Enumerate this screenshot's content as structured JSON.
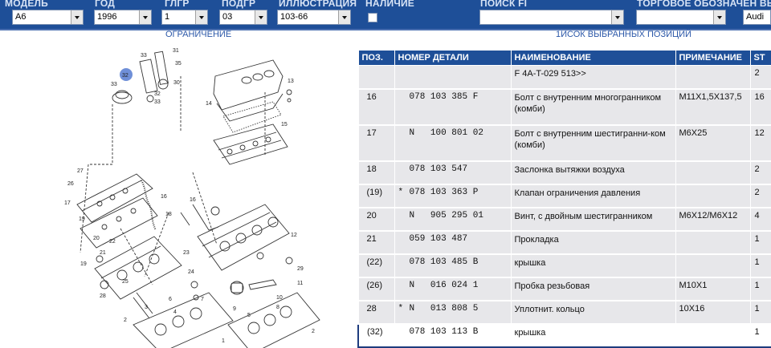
{
  "filters": {
    "model": {
      "label": "МОДЕЛЬ",
      "value": "A6"
    },
    "year": {
      "label": "ГОД",
      "value": "1996"
    },
    "main_group": {
      "label": "ГЛГР",
      "value": "1"
    },
    "sub_group": {
      "label": "ПОДГР",
      "value": "03"
    },
    "illustration": {
      "label": "ИЛЛЮСТРАЦИЯ",
      "value": "103-66"
    },
    "availability": {
      "label": "НАЛИЧИЕ"
    },
    "search": {
      "label": "ПОИСК FI",
      "value": ""
    },
    "trade": {
      "label": "ТОРГОВОЕ ОБОЗНАЧЕН ВЫБО",
      "value": "Audi"
    }
  },
  "subheader": {
    "left": "ОГРАНИЧЕНИЕ",
    "right": "1ИСОК ВЫБРАННЫХ ПОЗИЦИЙ"
  },
  "table": {
    "columns": [
      "ПОЗ.",
      "НОМЕР ДЕТАЛИ",
      "НАИМЕНОВАНИЕ",
      "ПРИМЕЧАНИЕ",
      "ST"
    ],
    "rows": [
      {
        "pos": "",
        "star": "",
        "part": "",
        "name": "F 4A-T-029 513>>",
        "note": "",
        "qty": "2",
        "tall": false,
        "selected": false
      },
      {
        "pos": "16",
        "star": "",
        "part": "078 103 385 F",
        "name": "Болт с внутренним многогранником (комби)",
        "note": "M11X1,5X137,5",
        "qty": "16",
        "tall": true,
        "selected": false
      },
      {
        "pos": "17",
        "star": "",
        "part": "N   100 801 02",
        "name": "Болт с внутренним шестигранни-ком (комби)",
        "note": "M6X25",
        "qty": "12",
        "tall": true,
        "selected": false
      },
      {
        "pos": "18",
        "star": "",
        "part": "078 103 547",
        "name": "Заслонка вытяжки воздуха",
        "note": "",
        "qty": "2",
        "tall": false,
        "selected": false
      },
      {
        "pos": "(19)",
        "star": "*",
        "part": "078 103 363 P",
        "name": "Клапан ограничения давления",
        "note": "",
        "qty": "2",
        "tall": false,
        "selected": false
      },
      {
        "pos": "20",
        "star": "",
        "part": "N   905 295 01",
        "name": "Винт, с двойным шестигранником",
        "note": "M6X12/M6X12",
        "qty": "4",
        "tall": false,
        "selected": false
      },
      {
        "pos": "21",
        "star": "",
        "part": "059 103 487",
        "name": "Прокладка",
        "note": "",
        "qty": "1",
        "tall": false,
        "selected": false
      },
      {
        "pos": "(22)",
        "star": "",
        "part": "078 103 485 B",
        "name": "крышка",
        "note": "",
        "qty": "1",
        "tall": false,
        "selected": false
      },
      {
        "pos": "(26)",
        "star": "",
        "part": "N   016 024 1",
        "name": "Пробка резьбовая",
        "note": "M10X1",
        "qty": "1",
        "tall": false,
        "selected": false
      },
      {
        "pos": "28",
        "star": "*",
        "part": "N   013 808 5",
        "name": "Уплотнит. кольцо",
        "note": "10X16",
        "qty": "1",
        "tall": false,
        "selected": false
      },
      {
        "pos": "(32)",
        "star": "",
        "part": "078 103 113 B",
        "name": "крышка",
        "note": "",
        "qty": "1",
        "tall": false,
        "selected": true
      }
    ]
  },
  "diagram": {
    "callouts": [
      "33",
      "31",
      "32",
      "33",
      "35",
      "30",
      "33",
      "32",
      "13",
      "14",
      "15",
      "27",
      "26",
      "17",
      "19",
      "16",
      "18",
      "16",
      "22",
      "20",
      "21",
      "19",
      "23",
      "24",
      "29",
      "12",
      "25",
      "28",
      "11",
      "9",
      "10",
      "8",
      "7",
      "2",
      "3",
      "6",
      "4",
      "5",
      "1",
      "2"
    ],
    "highlight": "32",
    "highlight_color": "#6f8fd8"
  },
  "colors": {
    "accent": "#1e4f98",
    "row_bg": "#e7e7ea",
    "label": "#d7e3f5",
    "subheader_text": "#2c58a8"
  }
}
